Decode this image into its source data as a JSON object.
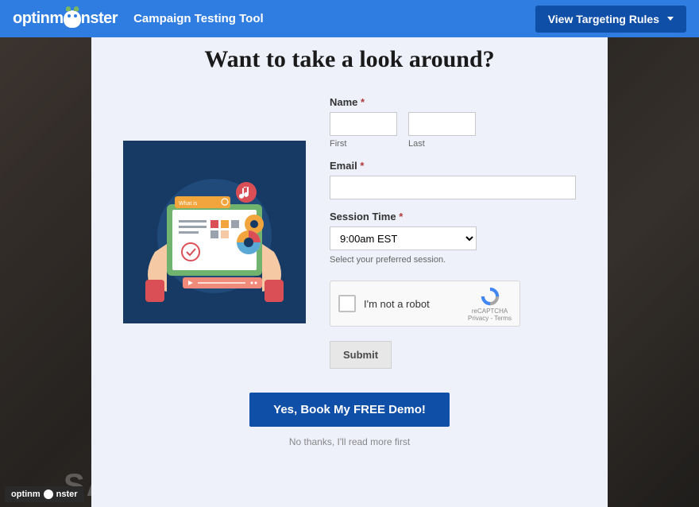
{
  "topbar": {
    "brand": "optinmonster",
    "tool_label": "Campaign Testing Tool",
    "view_rules_label": "View Targeting Rules"
  },
  "modal": {
    "title": "Want to take a look around?",
    "name_label": "Name",
    "name_first_sub": "First",
    "name_last_sub": "Last",
    "email_label": "Email",
    "session_label": "Session Time",
    "session_selected": "9:00am EST",
    "session_options": [
      "9:00am EST"
    ],
    "session_helper": "Select your preferred session.",
    "required_marker": "*",
    "recaptcha_label": "I'm not a robot",
    "recaptcha_brand": "reCAPTCHA",
    "recaptcha_links": "Privacy - Terms",
    "submit_label": "Submit",
    "primary_cta": "Yes, Book My FREE Demo!",
    "secondary_link": "No thanks, I'll read more first",
    "illustration_search_text": "What is"
  },
  "footer_badge": "optinmonster",
  "background_ghost_text": "SA",
  "colors": {
    "topbar_bg": "#2f7de1",
    "topbar_btn_bg": "#0f4fa8",
    "modal_bg": "#eef0fa",
    "illus_bg": "#163a64",
    "primary_cta_bg": "#0f4fa8",
    "required": "#b33a3a"
  }
}
